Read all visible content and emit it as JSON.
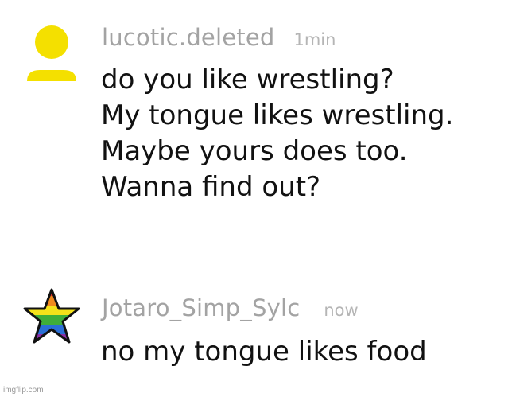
{
  "messages": [
    {
      "username": "lucotic.deleted",
      "timestamp": "1min",
      "avatar_icon": "yellow-person-icon",
      "avatar_color": "#f4e000",
      "lines": [
        "do you like wrestling?",
        "My tongue likes wrestling.",
        "Maybe yours does too.",
        "Wanna find out?"
      ]
    },
    {
      "username": "Jotaro_Simp_Sylc",
      "timestamp": "now",
      "avatar_icon": "rainbow-star-icon",
      "lines": [
        "no my tongue likes food"
      ]
    }
  ],
  "watermark": "imgflip.com"
}
